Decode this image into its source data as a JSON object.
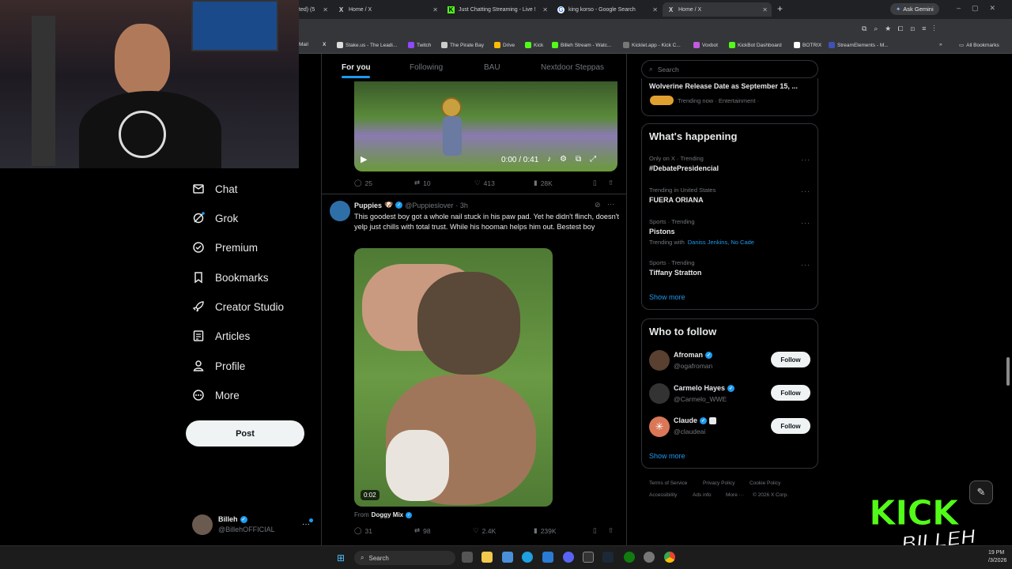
{
  "browser": {
    "tabs": [
      {
        "label": "ted) (5",
        "fav": ""
      },
      {
        "label": "Home / X",
        "fav": "X"
      },
      {
        "label": "Just Chatting Streaming - Live !",
        "fav": "K"
      },
      {
        "label": "king korso - Google Search",
        "fav": "G"
      },
      {
        "label": "Home / X",
        "fav": "X"
      }
    ],
    "new_tab": "+",
    "gemini": "Ask Gemini",
    "bookmarks": [
      "Mail",
      "",
      "Stake.us - The Leadi...",
      "Twitch",
      "The Pirate Bay",
      "Drive",
      "Kick",
      "Billeh Stream - Watc...",
      "Kicklet.app - Kick C...",
      "Voxbot",
      "KickBot Dashboard",
      "BOTRIX",
      "StreamElements - M..."
    ],
    "all_bookmarks": "All Bookmarks",
    "colors": {
      "accent": "#1d9bf0",
      "kick": "#53fc18"
    }
  },
  "nav": {
    "items": [
      "Chat",
      "Grok",
      "Premium",
      "Bookmarks",
      "Creator Studio",
      "Articles",
      "Profile",
      "More"
    ],
    "post": "Post"
  },
  "account": {
    "name": "Billeh",
    "handle": "@BillehOFFICIAL",
    "more": "···"
  },
  "feed": {
    "tabs": [
      "For you",
      "Following",
      "BAU",
      "Nextdoor Steppas"
    ],
    "video1": {
      "time": "0:00 / 0:41",
      "stats": {
        "replies": "25",
        "reposts": "10",
        "likes": "413",
        "views": "28K"
      }
    },
    "tweet": {
      "name": "Puppies",
      "emoji": "🐶",
      "handle": "@Puppieslover",
      "time": "· 3h",
      "text": "This goodest boy got a whole nail stuck in his paw pad. Yet he didn't flinch, doesn't yelp just chills with total trust. While his hooman helps him out. Bestest boy",
      "duration": "0:02",
      "from_label": "From",
      "from": "Doggy Mix",
      "stats": {
        "replies": "31",
        "reposts": "98",
        "likes": "2.4K",
        "views": "239K"
      }
    }
  },
  "right": {
    "search_placeholder": "Search",
    "top_trend": {
      "title": "Wolverine Release Date as September 15, ...",
      "meta": "Trending now · Entertainment ·"
    },
    "happening_title": "What's happening",
    "trends": [
      {
        "meta": "Only on X · Trending",
        "name": "#DebatePresidencial"
      },
      {
        "meta": "Trending in United States",
        "name": "FUERA ORIANA"
      },
      {
        "meta": "Sports · Trending",
        "name": "Pistons",
        "with": "Trending with",
        "with_links": "Daniss Jenkins, No Cade"
      },
      {
        "meta": "Sports · Trending",
        "name": "Tiffany Stratton"
      }
    ],
    "show_more": "Show more",
    "who_title": "Who to follow",
    "follow": [
      {
        "name": "Afroman",
        "handle": "@ogafroman"
      },
      {
        "name": "Carmelo Hayes",
        "handle": "@Carmelo_WWE"
      },
      {
        "name": "Claude",
        "handle": "@claudeai"
      }
    ],
    "follow_label": "Follow",
    "footer": [
      "Terms of Service",
      "Privacy Policy",
      "Cookie Policy",
      "Accessibility",
      "Ads info",
      "More ···",
      "© 2026 X Corp."
    ]
  },
  "overlay": {
    "kick": "KICK",
    "billeh": "BILLEH"
  },
  "taskbar": {
    "search": "Search",
    "clock": "19 PM",
    "date": "/3/2026"
  }
}
